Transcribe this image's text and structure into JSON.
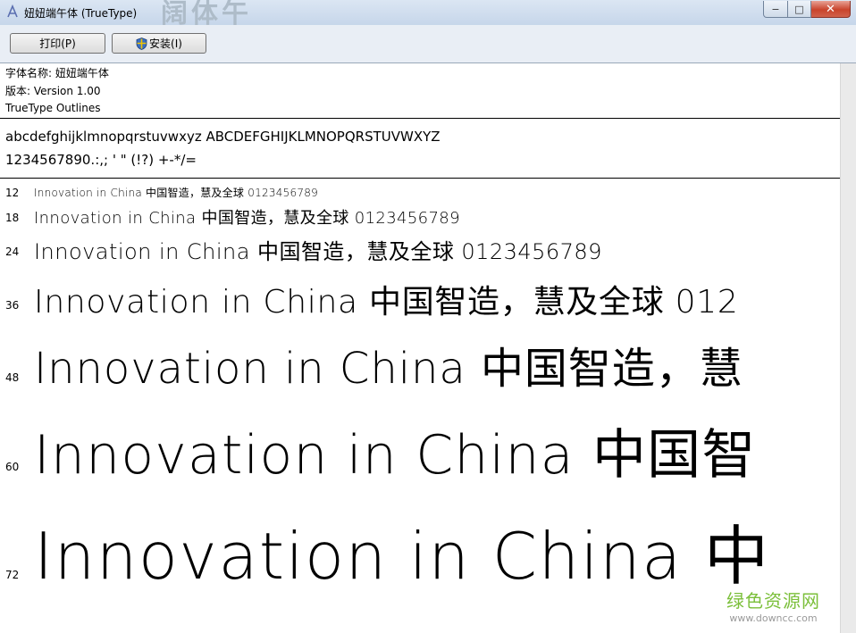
{
  "window": {
    "title": "妞妞端午体 (TrueType)",
    "ghost_title": "阔体午"
  },
  "controls": {
    "minimize": "−",
    "maximize": "□",
    "close": "✕"
  },
  "toolbar": {
    "print_label": "打印(P)",
    "install_label": "安装(I)"
  },
  "font_info": {
    "name_line": "字体名称: 妞妞端午体",
    "version_line": "版本: Version 1.00",
    "type_line": "TrueType Outlines"
  },
  "charset": {
    "letters": "abcdefghijklmnopqrstuvwxyz ABCDEFGHIJKLMNOPQRSTUVWXYZ",
    "digits": "1234567890.:,; ' \" (!?) +-*/="
  },
  "samples": [
    {
      "size": "12",
      "text": "Innovation in China 中国智造，慧及全球 0123456789"
    },
    {
      "size": "18",
      "text": "Innovation in China 中国智造，慧及全球 0123456789"
    },
    {
      "size": "24",
      "text": "Innovation in China 中国智造，慧及全球 0123456789"
    },
    {
      "size": "36",
      "text": "Innovation in China 中国智造，慧及全球 012"
    },
    {
      "size": "48",
      "text": "Innovation in China 中国智造，慧"
    },
    {
      "size": "60",
      "text": "Innovation in China 中国智"
    },
    {
      "size": "72",
      "text": "Innovation in China 中"
    }
  ],
  "watermark": {
    "cn": "绿色资源网",
    "url": "www.downcc.com"
  },
  "colors": {
    "titlebar": "#c6d6ea",
    "close_button": "#c9442c",
    "watermark_green": "#7bbf3a"
  }
}
